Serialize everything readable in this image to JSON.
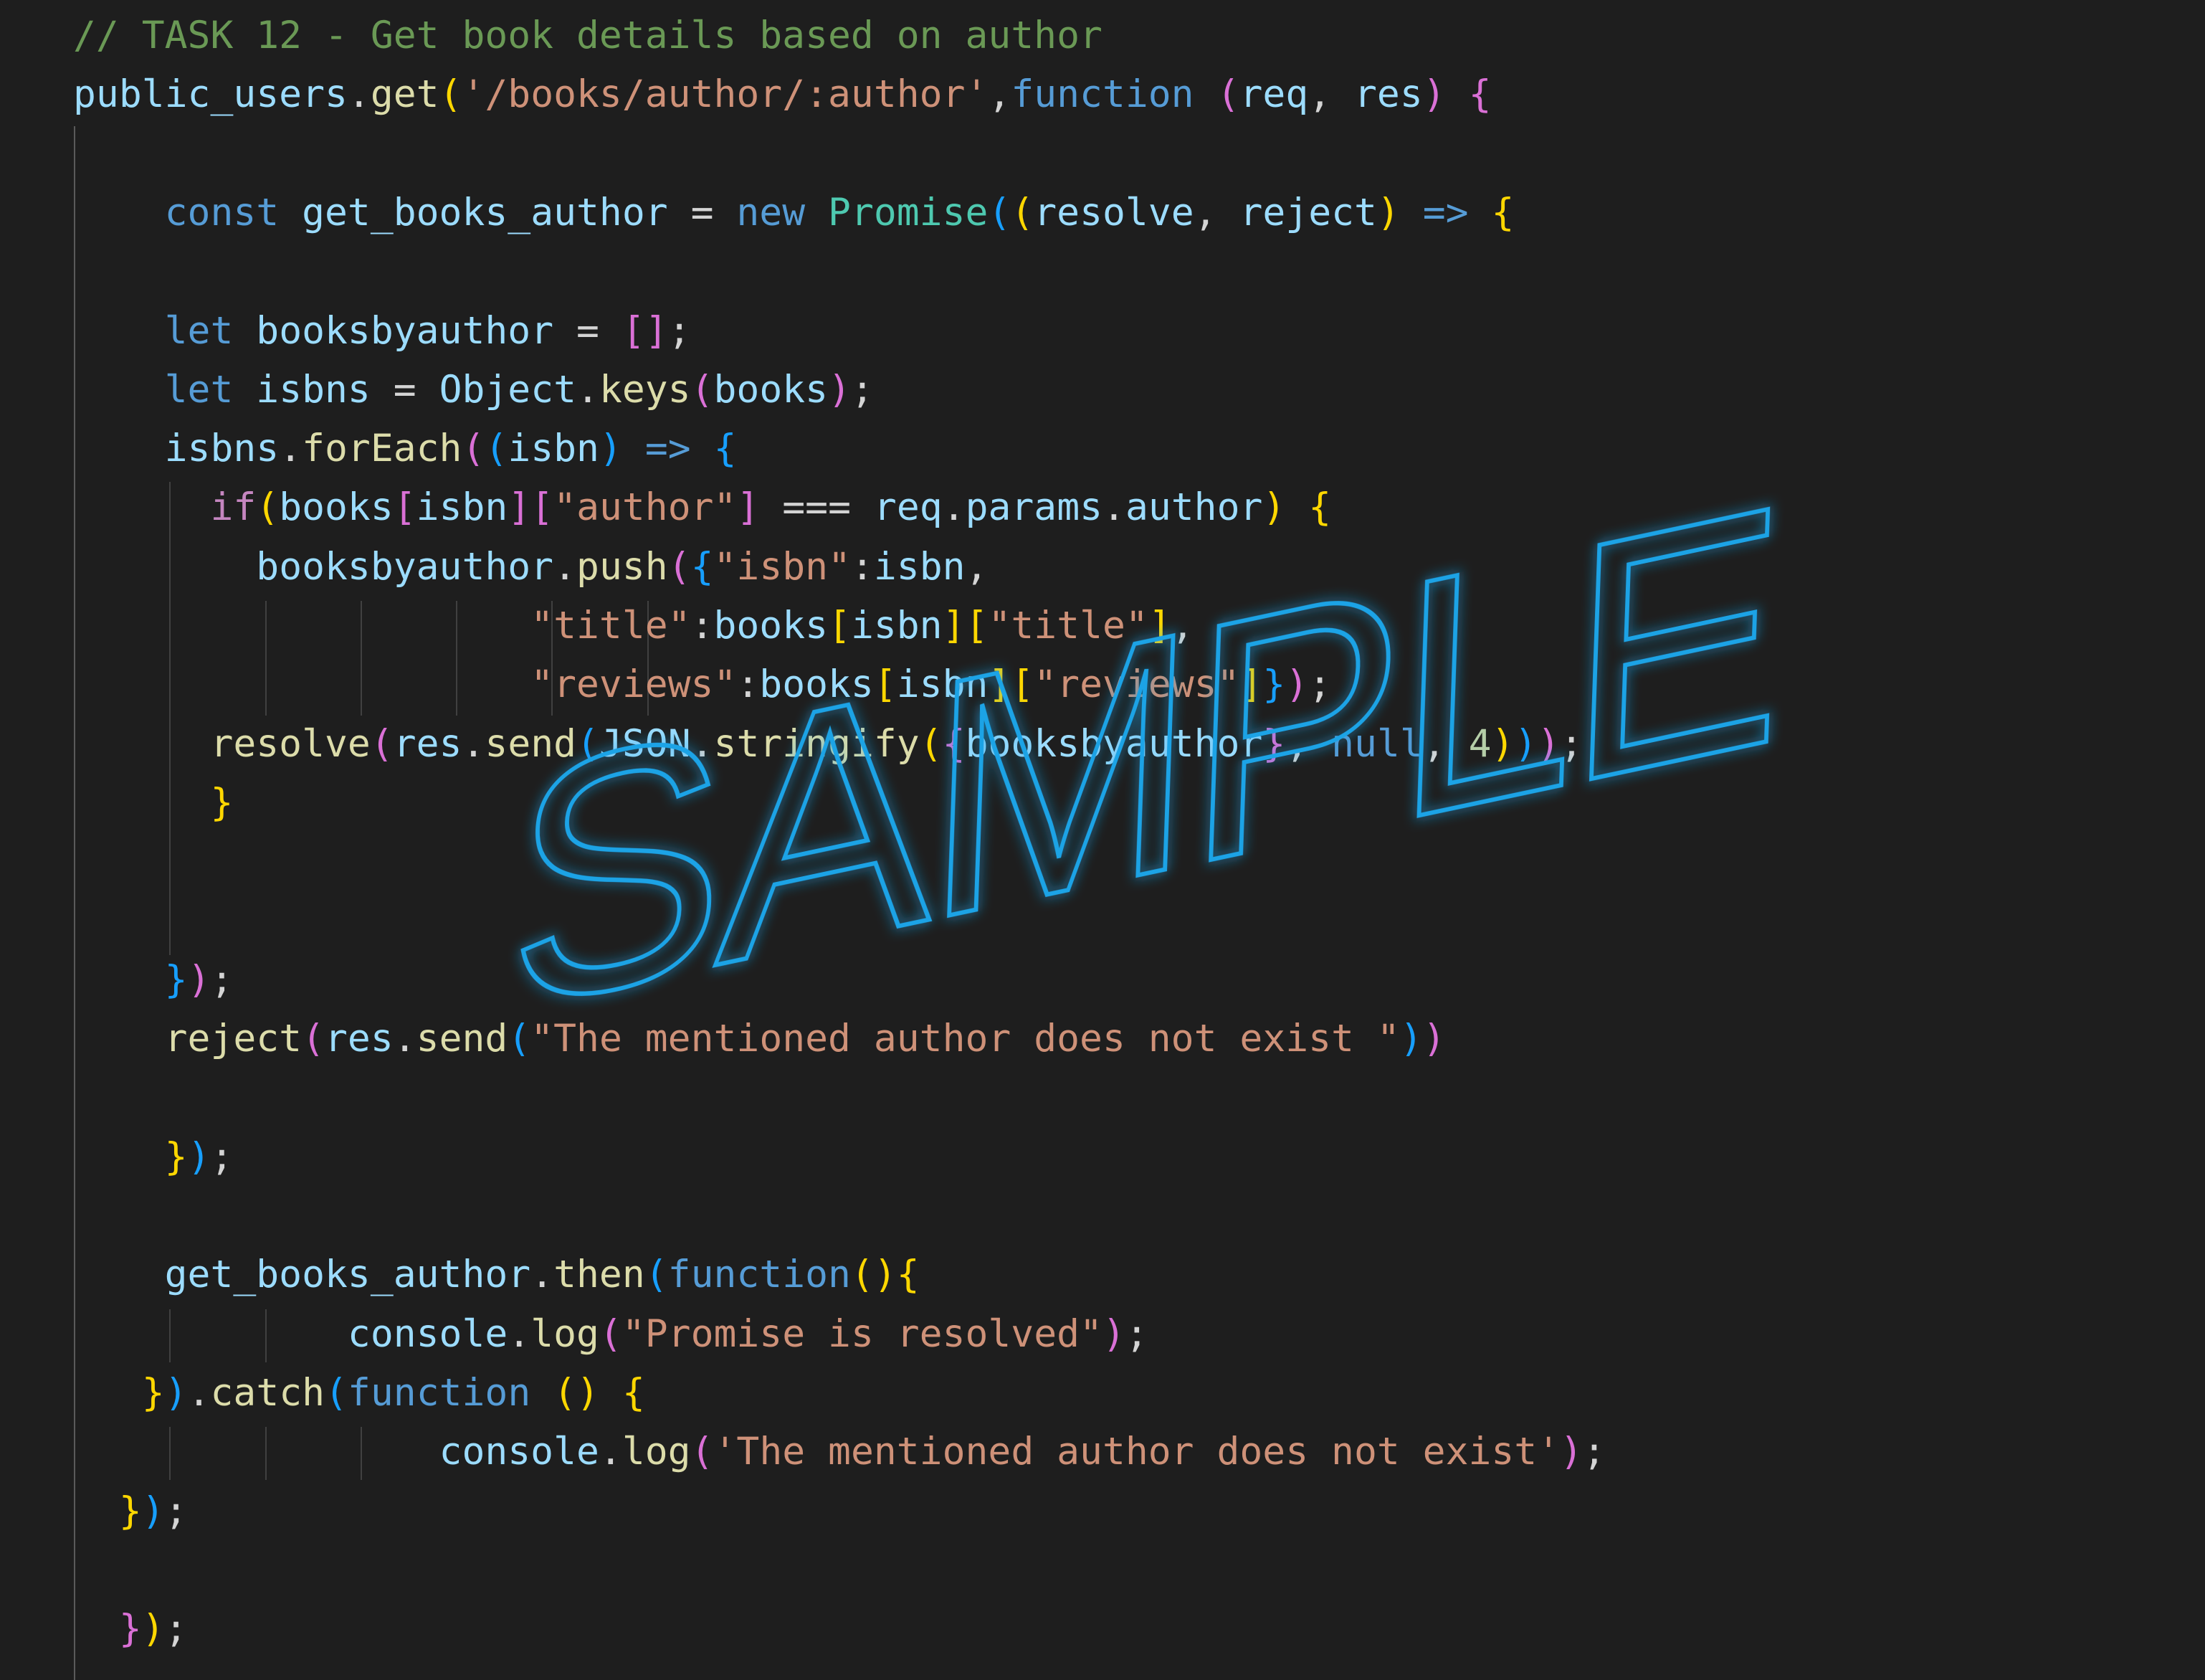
{
  "editor": {
    "lines": [
      [
        [
          "// TASK 12 - Get book details based on author",
          "cm"
        ]
      ],
      [
        [
          "public_users",
          "var"
        ],
        [
          ".",
          "op"
        ],
        [
          "get",
          "fn"
        ],
        [
          "(",
          "b1"
        ],
        [
          "'/books/author/:author'",
          "str"
        ],
        [
          ",",
          "op"
        ],
        [
          "function",
          "kw"
        ],
        [
          " ",
          "op"
        ],
        [
          "(",
          "b2"
        ],
        [
          "req",
          "var"
        ],
        [
          ", ",
          "op"
        ],
        [
          "res",
          "var"
        ],
        [
          ")",
          "b2"
        ],
        [
          " ",
          "op"
        ],
        [
          "{",
          "b2"
        ]
      ],
      [],
      [
        [
          "    ",
          "op"
        ],
        [
          "const",
          "kw"
        ],
        [
          " ",
          "op"
        ],
        [
          "get_books_author",
          "var"
        ],
        [
          " = ",
          "op"
        ],
        [
          "new",
          "kw"
        ],
        [
          " ",
          "op"
        ],
        [
          "Promise",
          "cls"
        ],
        [
          "(",
          "b3"
        ],
        [
          "(",
          "b1"
        ],
        [
          "resolve",
          "var"
        ],
        [
          ", ",
          "op"
        ],
        [
          "reject",
          "var"
        ],
        [
          ")",
          "b1"
        ],
        [
          " ",
          "op"
        ],
        [
          "=>",
          "kw"
        ],
        [
          " ",
          "op"
        ],
        [
          "{",
          "b1"
        ]
      ],
      [],
      [
        [
          "    ",
          "op"
        ],
        [
          "let",
          "kw"
        ],
        [
          " ",
          "op"
        ],
        [
          "booksbyauthor",
          "var"
        ],
        [
          " = ",
          "op"
        ],
        [
          "[",
          "b2"
        ],
        [
          "]",
          "b2"
        ],
        [
          ";",
          "op"
        ]
      ],
      [
        [
          "    ",
          "op"
        ],
        [
          "let",
          "kw"
        ],
        [
          " ",
          "op"
        ],
        [
          "isbns",
          "var"
        ],
        [
          " = ",
          "op"
        ],
        [
          "Object",
          "var"
        ],
        [
          ".",
          "op"
        ],
        [
          "keys",
          "fn"
        ],
        [
          "(",
          "b2"
        ],
        [
          "books",
          "var"
        ],
        [
          ")",
          "b2"
        ],
        [
          ";",
          "op"
        ]
      ],
      [
        [
          "    ",
          "op"
        ],
        [
          "isbns",
          "var"
        ],
        [
          ".",
          "op"
        ],
        [
          "forEach",
          "fn"
        ],
        [
          "(",
          "b2"
        ],
        [
          "(",
          "b3"
        ],
        [
          "isbn",
          "var"
        ],
        [
          ")",
          "b3"
        ],
        [
          " ",
          "op"
        ],
        [
          "=>",
          "kw"
        ],
        [
          " ",
          "op"
        ],
        [
          "{",
          "b3"
        ]
      ],
      [
        [
          "      ",
          "op"
        ],
        [
          "if",
          "kc"
        ],
        [
          "(",
          "b1"
        ],
        [
          "books",
          "var"
        ],
        [
          "[",
          "b2"
        ],
        [
          "isbn",
          "var"
        ],
        [
          "]",
          "b2"
        ],
        [
          "[",
          "b2"
        ],
        [
          "\"author\"",
          "str"
        ],
        [
          "]",
          "b2"
        ],
        [
          " === ",
          "op"
        ],
        [
          "req",
          "var"
        ],
        [
          ".",
          "op"
        ],
        [
          "params",
          "var"
        ],
        [
          ".",
          "op"
        ],
        [
          "author",
          "var"
        ],
        [
          ")",
          "b1"
        ],
        [
          " ",
          "op"
        ],
        [
          "{",
          "b1"
        ]
      ],
      [
        [
          "        ",
          "op"
        ],
        [
          "booksbyauthor",
          "var"
        ],
        [
          ".",
          "op"
        ],
        [
          "push",
          "fn"
        ],
        [
          "(",
          "b2"
        ],
        [
          "{",
          "b3"
        ],
        [
          "\"isbn\"",
          "str"
        ],
        [
          ":",
          "op"
        ],
        [
          "isbn",
          "var"
        ],
        [
          ",",
          "op"
        ]
      ],
      [
        [
          "                    ",
          "op"
        ],
        [
          "\"title\"",
          "str"
        ],
        [
          ":",
          "op"
        ],
        [
          "books",
          "var"
        ],
        [
          "[",
          "b1"
        ],
        [
          "isbn",
          "var"
        ],
        [
          "]",
          "b1"
        ],
        [
          "[",
          "b1"
        ],
        [
          "\"title\"",
          "str"
        ],
        [
          "]",
          "b1"
        ],
        [
          ",",
          "op"
        ]
      ],
      [
        [
          "                    ",
          "op"
        ],
        [
          "\"reviews\"",
          "str"
        ],
        [
          ":",
          "op"
        ],
        [
          "books",
          "var"
        ],
        [
          "[",
          "b1"
        ],
        [
          "isbn",
          "var"
        ],
        [
          "]",
          "b1"
        ],
        [
          "[",
          "b1"
        ],
        [
          "\"reviews\"",
          "str"
        ],
        [
          "]",
          "b1"
        ],
        [
          "}",
          "b3"
        ],
        [
          ")",
          "b2"
        ],
        [
          ";",
          "op"
        ]
      ],
      [
        [
          "      ",
          "op"
        ],
        [
          "resolve",
          "fn"
        ],
        [
          "(",
          "b2"
        ],
        [
          "res",
          "var"
        ],
        [
          ".",
          "op"
        ],
        [
          "send",
          "fn"
        ],
        [
          "(",
          "b3"
        ],
        [
          "JSON",
          "var"
        ],
        [
          ".",
          "op"
        ],
        [
          "stringify",
          "fn"
        ],
        [
          "(",
          "b1"
        ],
        [
          "{",
          "b2"
        ],
        [
          "booksbyauthor",
          "var"
        ],
        [
          "}",
          "b2"
        ],
        [
          ", ",
          "op"
        ],
        [
          "null",
          "kw"
        ],
        [
          ", ",
          "op"
        ],
        [
          "4",
          "num"
        ],
        [
          ")",
          "b1"
        ],
        [
          ")",
          "b3"
        ],
        [
          ")",
          "b2"
        ],
        [
          ";",
          "op"
        ]
      ],
      [
        [
          "      ",
          "op"
        ],
        [
          "}",
          "b1"
        ]
      ],
      [],
      [],
      [
        [
          "    ",
          "op"
        ],
        [
          "}",
          "b3"
        ],
        [
          ")",
          "b2"
        ],
        [
          ";",
          "op"
        ]
      ],
      [
        [
          "    ",
          "op"
        ],
        [
          "reject",
          "fn"
        ],
        [
          "(",
          "b2"
        ],
        [
          "res",
          "var"
        ],
        [
          ".",
          "op"
        ],
        [
          "send",
          "fn"
        ],
        [
          "(",
          "b3"
        ],
        [
          "\"The mentioned author does not exist \"",
          "str"
        ],
        [
          ")",
          "b3"
        ],
        [
          ")",
          "b2"
        ]
      ],
      [],
      [
        [
          "    ",
          "op"
        ],
        [
          "}",
          "b1"
        ],
        [
          ")",
          "b3"
        ],
        [
          ";",
          "op"
        ]
      ],
      [],
      [
        [
          "    ",
          "op"
        ],
        [
          "get_books_author",
          "var"
        ],
        [
          ".",
          "op"
        ],
        [
          "then",
          "fn"
        ],
        [
          "(",
          "b3"
        ],
        [
          "function",
          "kw"
        ],
        [
          "(",
          "b1"
        ],
        [
          ")",
          "b1"
        ],
        [
          "{",
          "b1"
        ]
      ],
      [
        [
          "            ",
          "op"
        ],
        [
          "console",
          "var"
        ],
        [
          ".",
          "op"
        ],
        [
          "log",
          "fn"
        ],
        [
          "(",
          "b2"
        ],
        [
          "\"Promise is resolved\"",
          "str"
        ],
        [
          ")",
          "b2"
        ],
        [
          ";",
          "op"
        ]
      ],
      [
        [
          "   ",
          "op"
        ],
        [
          "}",
          "b1"
        ],
        [
          ")",
          "b3"
        ],
        [
          ".",
          "op"
        ],
        [
          "catch",
          "fn"
        ],
        [
          "(",
          "b3"
        ],
        [
          "function",
          "kw"
        ],
        [
          " ",
          "op"
        ],
        [
          "(",
          "b1"
        ],
        [
          ")",
          "b1"
        ],
        [
          " ",
          "op"
        ],
        [
          "{",
          "b1"
        ]
      ],
      [
        [
          "                ",
          "op"
        ],
        [
          "console",
          "var"
        ],
        [
          ".",
          "op"
        ],
        [
          "log",
          "fn"
        ],
        [
          "(",
          "b2"
        ],
        [
          "'The mentioned author does not exist'",
          "str"
        ],
        [
          ")",
          "b2"
        ],
        [
          ";",
          "op"
        ]
      ],
      [
        [
          "  ",
          "op"
        ],
        [
          "}",
          "b1"
        ],
        [
          ")",
          "b3"
        ],
        [
          ";",
          "op"
        ]
      ],
      [],
      [
        [
          "  ",
          "op"
        ],
        [
          "}",
          "b2"
        ],
        [
          ")",
          "b1"
        ],
        [
          ";",
          "op"
        ]
      ]
    ]
  },
  "watermark": {
    "text": "SAMPLE",
    "color": "#1fa3e6"
  },
  "theme": {
    "background": "#1e1e1e",
    "comment": "#6a9955",
    "keyword": "#569cd6",
    "control": "#c586c0",
    "variable": "#9cdcfe",
    "function": "#dcdcaa",
    "string": "#ce9178",
    "class": "#4ec9b0",
    "number": "#b5cea8",
    "bracket_1": "#ffd700",
    "bracket_2": "#da70d6",
    "bracket_3": "#179fff"
  }
}
